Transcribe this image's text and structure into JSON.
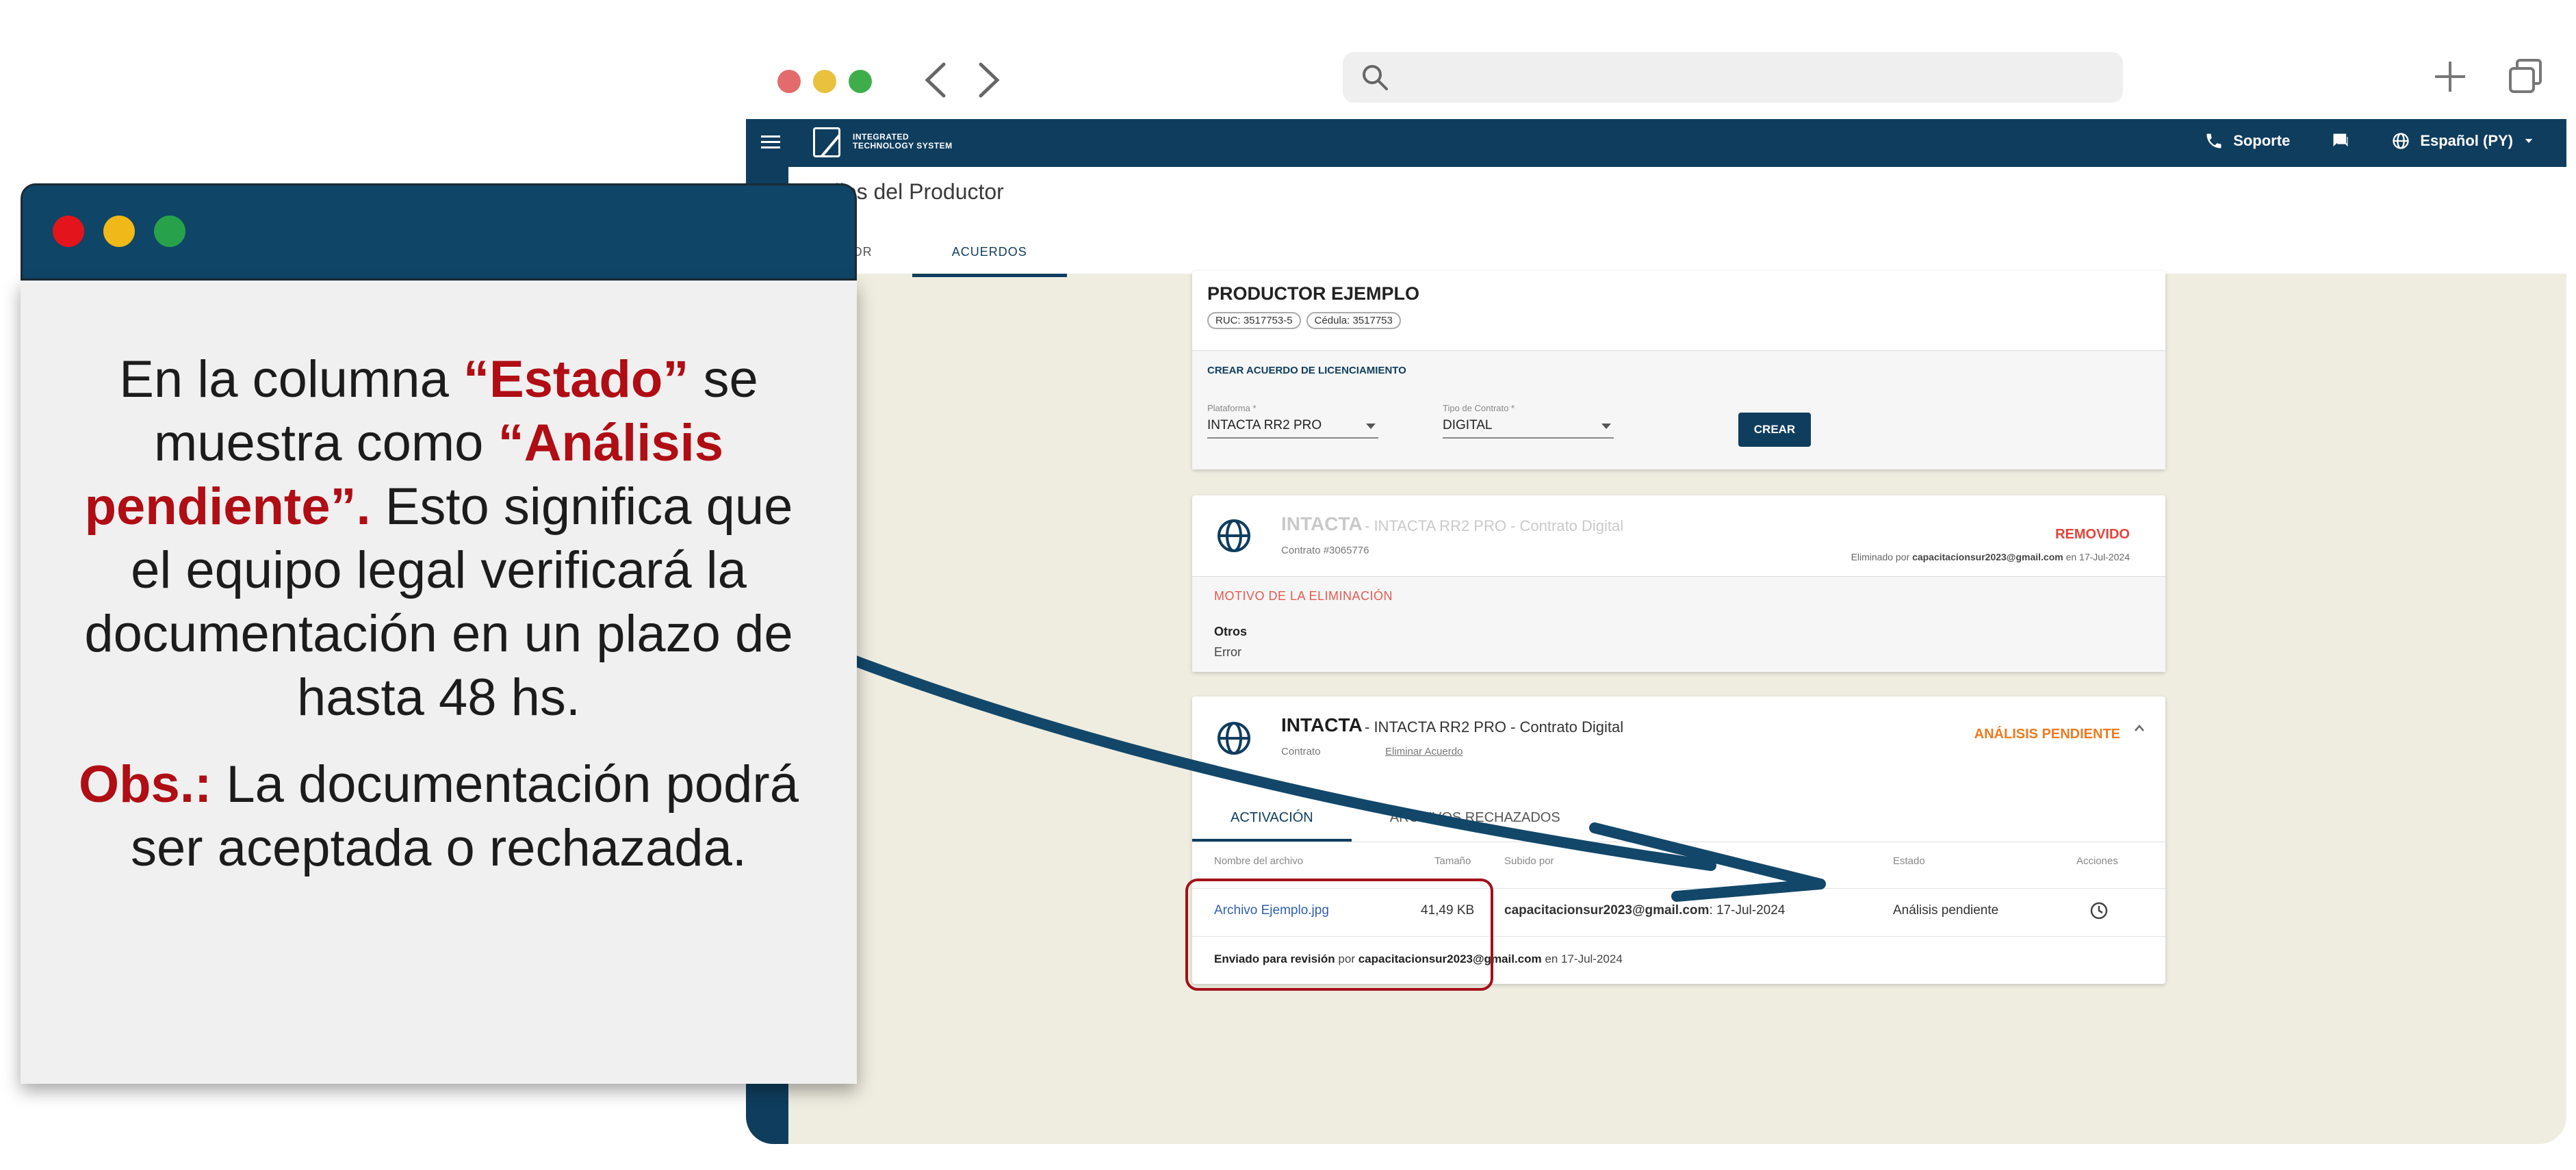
{
  "browser": {
    "dot_colors": [
      "#e46b6b",
      "#e9c13e",
      "#3fae4a"
    ]
  },
  "appbar": {
    "logo_line1": "INTEGRATED",
    "logo_line2": "TECHNOLOGY SYSTEM",
    "support_label": "Soporte",
    "language_label": "Español (PY)",
    "icons": [
      "menu-icon",
      "phone-icon",
      "chat-icon",
      "globe-icon",
      "caret-down-icon"
    ]
  },
  "page": {
    "title": "Detalles del Productor",
    "tabs": [
      {
        "label": "PRODUCTOR",
        "active": false
      },
      {
        "label": "ACUERDOS",
        "active": true
      }
    ]
  },
  "producer_card": {
    "name": "PRODUCTOR EJEMPLO",
    "ruc": "RUC: 3517753-5",
    "cedula": "Cédula: 3517753",
    "create_title": "CREAR ACUERDO DE LICENCIAMIENTO",
    "platform_label": "Plataforma *",
    "platform_value": "INTACTA RR2 PRO",
    "contract_type_label": "Tipo de Contrato *",
    "contract_type_value": "DIGITAL",
    "create_button": "CREAR"
  },
  "removed_agreement": {
    "title": "INTACTA",
    "subtitle": " - INTACTA RR2 PRO - Contrato Digital",
    "contract": "Contrato #3065776",
    "status": "REMOVIDO",
    "removed_prefix": "Eliminado por ",
    "removed_by": "capacitacionsur2023@gmail.com",
    "removed_suffix": " en 17-Jul-2024",
    "reason_title": "MOTIVO DE LA ELIMINACIÓN",
    "reason": "Otros",
    "reason_detail": "Error"
  },
  "pending_agreement": {
    "title": "INTACTA",
    "subtitle": " - INTACTA RR2 PRO - Contrato Digital",
    "contract": "Contrato",
    "delete_link": "Eliminar Acuerdo",
    "status": "ANÁLISIS PENDIENTE",
    "tabs": [
      "ACTIVACIÓN",
      "ARCHIVOS RECHAZADOS"
    ],
    "columns": {
      "file_name": "Nombre del archivo",
      "size": "Tamaño",
      "uploaded_by": "Subido por",
      "status": "Estado",
      "actions": "Acciones"
    },
    "row": {
      "file_name": "Archivo Ejemplo.jpg",
      "size": "41,49 KB",
      "uploaded_by": "capacitacionsur2023@gmail.com",
      "uploaded_date": ": 17-Jul-2024",
      "status": "Análisis pendiente"
    },
    "sent_prefix": "Enviado para revisión",
    "sent_mid": " por ",
    "sent_by": "capacitacionsur2023@gmail.com",
    "sent_suffix": " en 17-Jul-2024"
  },
  "callout": {
    "dot_colors": [
      "#e3141b",
      "#f0b818",
      "#27a24a"
    ],
    "p1_a": "En la columna ",
    "p1_b": "“Estado”",
    "p1_c": " se muestra como ",
    "p1_d": "“Análisis pendiente”.",
    "p1_e": " Esto significa que el equipo legal verificará la documentación en un plazo de hasta 48 hs.",
    "p2_a": "Obs.:",
    "p2_b": " La documentación podrá ser aceptada o rechazada."
  }
}
